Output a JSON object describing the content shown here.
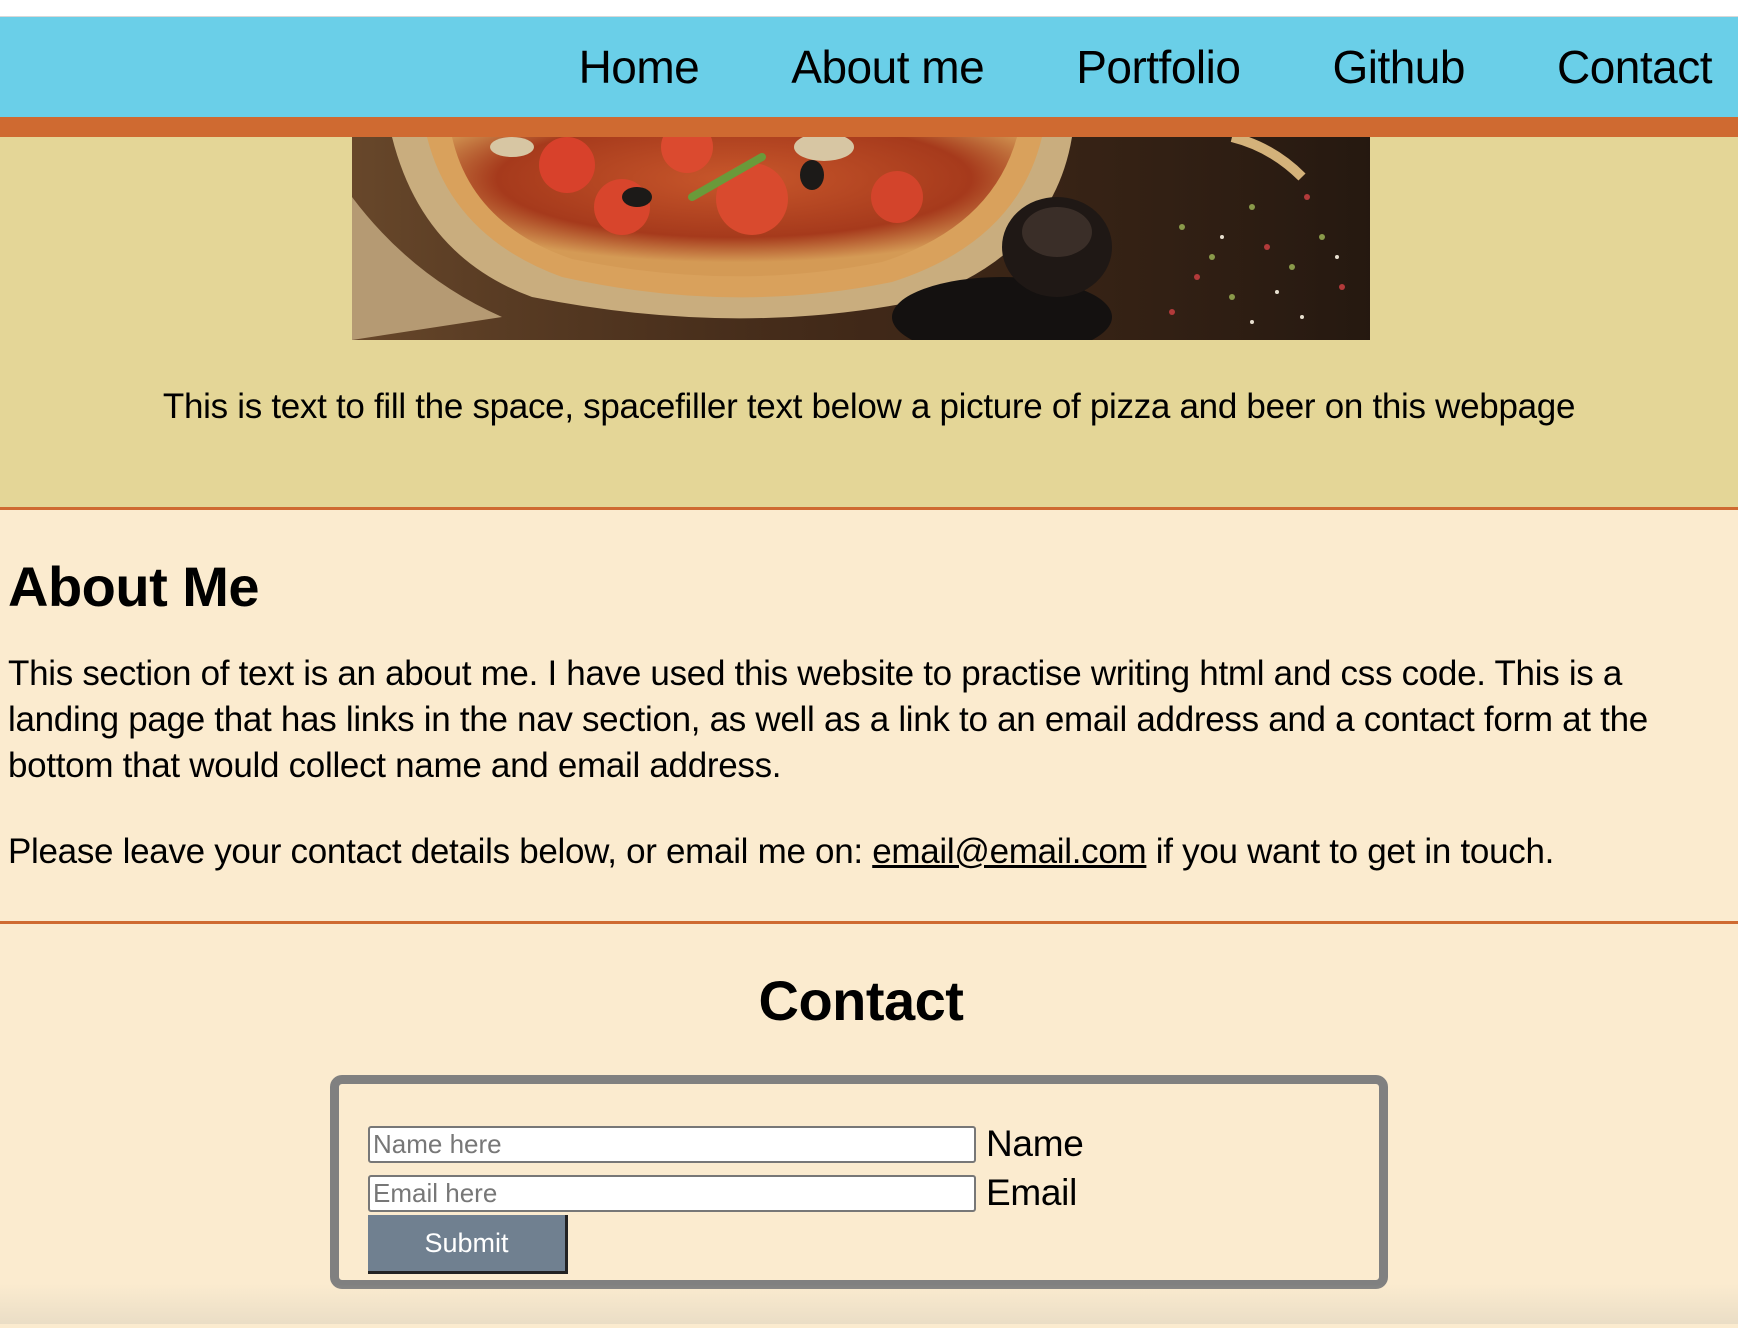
{
  "nav": {
    "items": [
      {
        "label": "Home"
      },
      {
        "label": "About me"
      },
      {
        "label": "Portfolio"
      },
      {
        "label": "Github"
      },
      {
        "label": "Contact"
      }
    ]
  },
  "hero": {
    "image_icon": "pizza-photo",
    "caption": "This is text to fill the space, spacefiller text below a picture of pizza and beer on this webpage"
  },
  "about": {
    "title": "About Me",
    "paragraph1": "This section of text is an about me. I have used this website to practise writing html and css code. This is a landing page that has links in the nav section, as well as a link to an email address and a contact form at the bottom that would collect name and email address.",
    "paragraph2_before": "Please leave your contact details below, or email me on: ",
    "email": "email@email.com",
    "paragraph2_after": " if you want to get in touch."
  },
  "contact": {
    "title": "Contact",
    "name_placeholder": "Name here",
    "name_value": "",
    "name_label": "Name",
    "email_placeholder": "Email here",
    "email_value": "",
    "email_label": "Email",
    "submit_label": "Submit"
  },
  "colors": {
    "nav_bg": "#6acfe8",
    "accent": "#cf6a31",
    "hero_bg": "#e4d697",
    "page_bg": "#fbebcf",
    "button_bg": "#708090"
  }
}
